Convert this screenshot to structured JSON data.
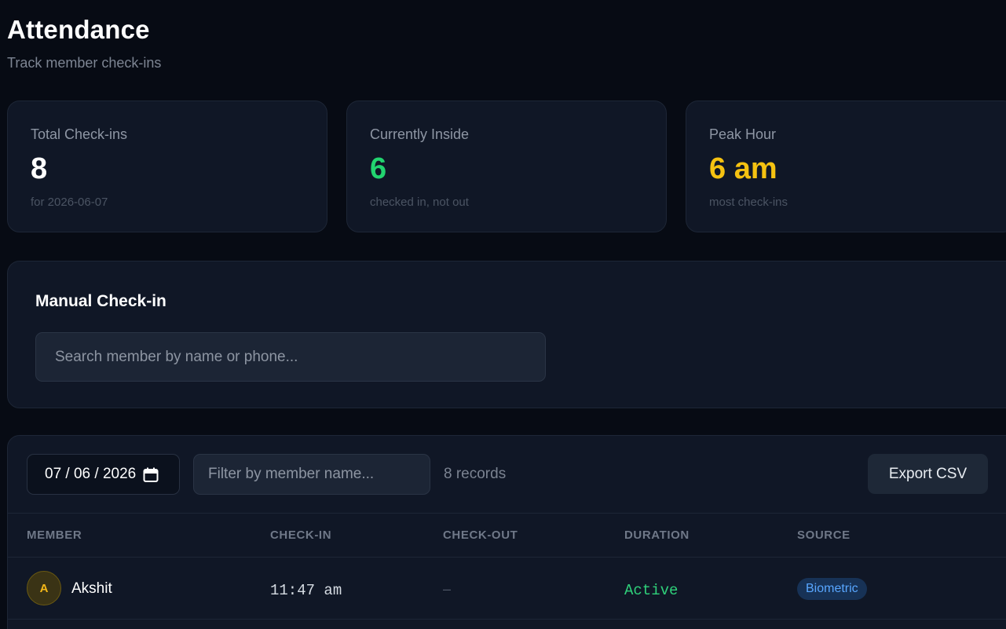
{
  "header": {
    "title": "Attendance",
    "subtitle": "Track member check-ins"
  },
  "stats": [
    {
      "label": "Total Check-ins",
      "value": "8",
      "note": "for 2026-06-07",
      "color": "#ffffff"
    },
    {
      "label": "Currently Inside",
      "value": "6",
      "note": "checked in, not out",
      "color": "#22d46f"
    },
    {
      "label": "Peak Hour",
      "value": "6 am",
      "note": "most check-ins",
      "color": "#f5c211"
    }
  ],
  "manual_checkin": {
    "heading": "Manual Check-in",
    "search_placeholder": "Search member by name or phone..."
  },
  "records": {
    "date_value": "07 / 06 / 2026",
    "filter_placeholder": "Filter by member name...",
    "count": "8 records",
    "export_label": "Export CSV",
    "columns": [
      "MEMBER",
      "CHECK-IN",
      "CHECK-OUT",
      "DURATION",
      "SOURCE"
    ],
    "rows": [
      {
        "initial": "A",
        "name": "Akshit",
        "check_in": "11:47 am",
        "check_out": "–",
        "duration": "Active",
        "source": "Biometric"
      }
    ]
  },
  "icons": {
    "date": "calendar-icon"
  }
}
